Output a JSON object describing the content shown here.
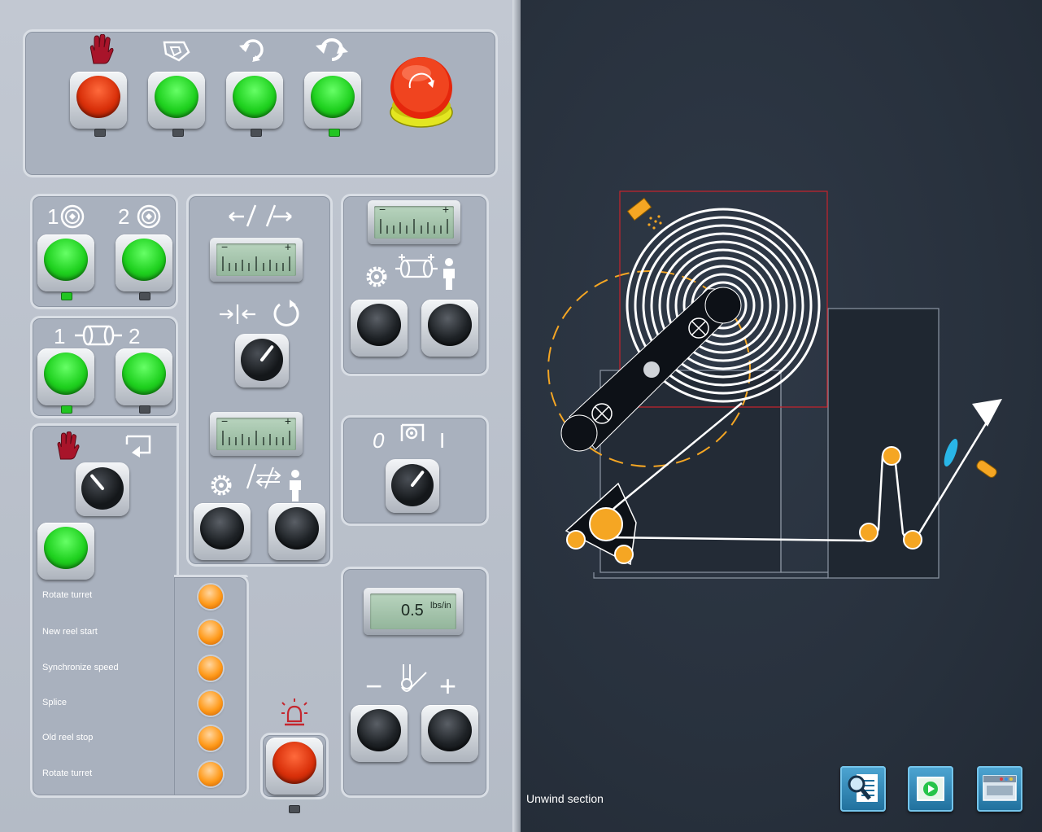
{
  "right_panel": {
    "section_label": "Unwind section",
    "nav_buttons": [
      {
        "icon": "document-zoom-icon"
      },
      {
        "icon": "play-screen-icon"
      },
      {
        "icon": "machine-overview-icon"
      }
    ]
  },
  "top_controls": {
    "buttons": [
      {
        "icon": "hand-stop-icon",
        "cap": "red",
        "led_on": false
      },
      {
        "icon": "rotate-left-icon",
        "cap": "green",
        "led_on": false
      },
      {
        "icon": "rotate-ccw-icon",
        "cap": "green",
        "led_on": false
      },
      {
        "icon": "rotate-cw-icon",
        "cap": "green",
        "led_on": true
      }
    ],
    "emergency_stop": {
      "icon": "emergency-stop-icon"
    }
  },
  "reel_select": {
    "labels": [
      "1",
      "2"
    ],
    "leds_on": [
      true,
      false
    ]
  },
  "roll_select": {
    "labels": [
      "1",
      "2"
    ],
    "leds_on": [
      true,
      false
    ]
  },
  "tension_display": {
    "value": "0.5",
    "unit": "lbs/in"
  },
  "mode_switch": {
    "off_label": "0",
    "on_label": "I"
  },
  "sequence_lamps": [
    {
      "label": "Rotate turret"
    },
    {
      "label": "New reel start"
    },
    {
      "label": "Synchronize speed"
    },
    {
      "label": "Splice"
    },
    {
      "label": "Old reel stop"
    },
    {
      "label": "Rotate turret"
    }
  ],
  "meters": {
    "minus_label": "−",
    "plus_label": "+"
  },
  "tension_adjust": {
    "minus_label": "−",
    "plus_label": "+"
  },
  "colors": {
    "accent_green": "#1fd11f",
    "accent_red": "#d9300a",
    "lamp_orange": "#ff9a1a",
    "diagram_orange": "#f5a623",
    "nav_blue": "#1f6f9c"
  }
}
